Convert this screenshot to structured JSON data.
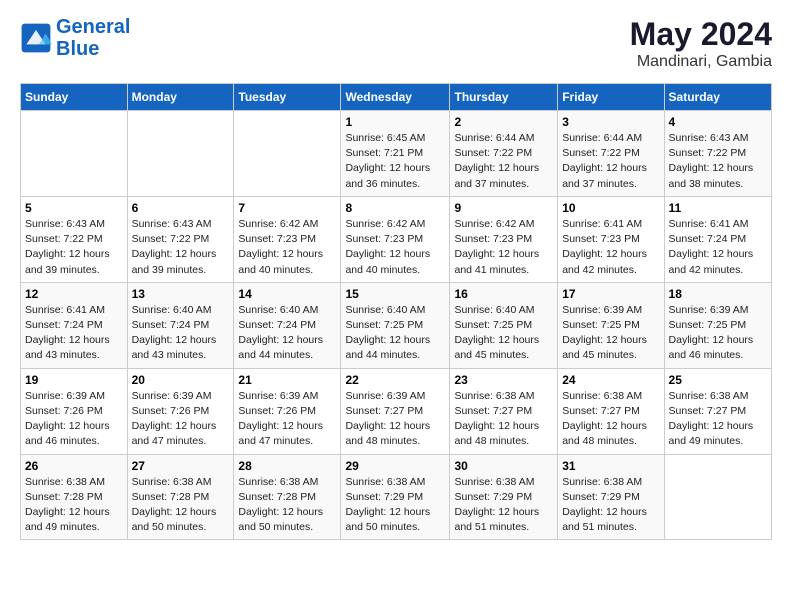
{
  "header": {
    "logo_line1": "General",
    "logo_line2": "Blue",
    "main_title": "May 2024",
    "subtitle": "Mandinari, Gambia"
  },
  "weekdays": [
    "Sunday",
    "Monday",
    "Tuesday",
    "Wednesday",
    "Thursday",
    "Friday",
    "Saturday"
  ],
  "weeks": [
    [
      {
        "day": "",
        "info": ""
      },
      {
        "day": "",
        "info": ""
      },
      {
        "day": "",
        "info": ""
      },
      {
        "day": "1",
        "info": "Sunrise: 6:45 AM\nSunset: 7:21 PM\nDaylight: 12 hours\nand 36 minutes."
      },
      {
        "day": "2",
        "info": "Sunrise: 6:44 AM\nSunset: 7:22 PM\nDaylight: 12 hours\nand 37 minutes."
      },
      {
        "day": "3",
        "info": "Sunrise: 6:44 AM\nSunset: 7:22 PM\nDaylight: 12 hours\nand 37 minutes."
      },
      {
        "day": "4",
        "info": "Sunrise: 6:43 AM\nSunset: 7:22 PM\nDaylight: 12 hours\nand 38 minutes."
      }
    ],
    [
      {
        "day": "5",
        "info": "Sunrise: 6:43 AM\nSunset: 7:22 PM\nDaylight: 12 hours\nand 39 minutes."
      },
      {
        "day": "6",
        "info": "Sunrise: 6:43 AM\nSunset: 7:22 PM\nDaylight: 12 hours\nand 39 minutes."
      },
      {
        "day": "7",
        "info": "Sunrise: 6:42 AM\nSunset: 7:23 PM\nDaylight: 12 hours\nand 40 minutes."
      },
      {
        "day": "8",
        "info": "Sunrise: 6:42 AM\nSunset: 7:23 PM\nDaylight: 12 hours\nand 40 minutes."
      },
      {
        "day": "9",
        "info": "Sunrise: 6:42 AM\nSunset: 7:23 PM\nDaylight: 12 hours\nand 41 minutes."
      },
      {
        "day": "10",
        "info": "Sunrise: 6:41 AM\nSunset: 7:23 PM\nDaylight: 12 hours\nand 42 minutes."
      },
      {
        "day": "11",
        "info": "Sunrise: 6:41 AM\nSunset: 7:24 PM\nDaylight: 12 hours\nand 42 minutes."
      }
    ],
    [
      {
        "day": "12",
        "info": "Sunrise: 6:41 AM\nSunset: 7:24 PM\nDaylight: 12 hours\nand 43 minutes."
      },
      {
        "day": "13",
        "info": "Sunrise: 6:40 AM\nSunset: 7:24 PM\nDaylight: 12 hours\nand 43 minutes."
      },
      {
        "day": "14",
        "info": "Sunrise: 6:40 AM\nSunset: 7:24 PM\nDaylight: 12 hours\nand 44 minutes."
      },
      {
        "day": "15",
        "info": "Sunrise: 6:40 AM\nSunset: 7:25 PM\nDaylight: 12 hours\nand 44 minutes."
      },
      {
        "day": "16",
        "info": "Sunrise: 6:40 AM\nSunset: 7:25 PM\nDaylight: 12 hours\nand 45 minutes."
      },
      {
        "day": "17",
        "info": "Sunrise: 6:39 AM\nSunset: 7:25 PM\nDaylight: 12 hours\nand 45 minutes."
      },
      {
        "day": "18",
        "info": "Sunrise: 6:39 AM\nSunset: 7:25 PM\nDaylight: 12 hours\nand 46 minutes."
      }
    ],
    [
      {
        "day": "19",
        "info": "Sunrise: 6:39 AM\nSunset: 7:26 PM\nDaylight: 12 hours\nand 46 minutes."
      },
      {
        "day": "20",
        "info": "Sunrise: 6:39 AM\nSunset: 7:26 PM\nDaylight: 12 hours\nand 47 minutes."
      },
      {
        "day": "21",
        "info": "Sunrise: 6:39 AM\nSunset: 7:26 PM\nDaylight: 12 hours\nand 47 minutes."
      },
      {
        "day": "22",
        "info": "Sunrise: 6:39 AM\nSunset: 7:27 PM\nDaylight: 12 hours\nand 48 minutes."
      },
      {
        "day": "23",
        "info": "Sunrise: 6:38 AM\nSunset: 7:27 PM\nDaylight: 12 hours\nand 48 minutes."
      },
      {
        "day": "24",
        "info": "Sunrise: 6:38 AM\nSunset: 7:27 PM\nDaylight: 12 hours\nand 48 minutes."
      },
      {
        "day": "25",
        "info": "Sunrise: 6:38 AM\nSunset: 7:27 PM\nDaylight: 12 hours\nand 49 minutes."
      }
    ],
    [
      {
        "day": "26",
        "info": "Sunrise: 6:38 AM\nSunset: 7:28 PM\nDaylight: 12 hours\nand 49 minutes."
      },
      {
        "day": "27",
        "info": "Sunrise: 6:38 AM\nSunset: 7:28 PM\nDaylight: 12 hours\nand 50 minutes."
      },
      {
        "day": "28",
        "info": "Sunrise: 6:38 AM\nSunset: 7:28 PM\nDaylight: 12 hours\nand 50 minutes."
      },
      {
        "day": "29",
        "info": "Sunrise: 6:38 AM\nSunset: 7:29 PM\nDaylight: 12 hours\nand 50 minutes."
      },
      {
        "day": "30",
        "info": "Sunrise: 6:38 AM\nSunset: 7:29 PM\nDaylight: 12 hours\nand 51 minutes."
      },
      {
        "day": "31",
        "info": "Sunrise: 6:38 AM\nSunset: 7:29 PM\nDaylight: 12 hours\nand 51 minutes."
      },
      {
        "day": "",
        "info": ""
      }
    ]
  ]
}
